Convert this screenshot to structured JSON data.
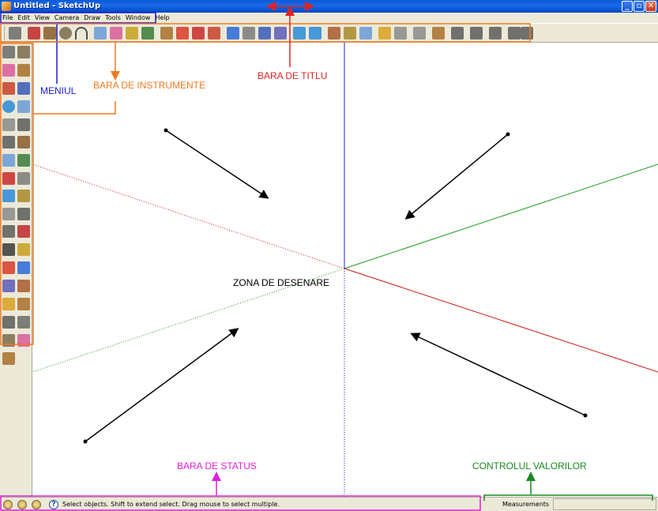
{
  "window": {
    "title": "Untitled - SketchUp",
    "buttons": {
      "minimize": "_",
      "maximize": "▫",
      "close": "✕"
    }
  },
  "menu": [
    "File",
    "Edit",
    "View",
    "Camera",
    "Draw",
    "Tools",
    "Window",
    "Help"
  ],
  "toolbar": {
    "tools": [
      "select-icon",
      "pencil-icon",
      "rectangle-icon",
      "circle-icon",
      "arc-icon",
      "make-component-icon",
      "eraser-icon",
      "tape-measure-icon",
      "paint-bucket-icon",
      "push-pull-icon",
      "move-icon",
      "rotate-icon",
      "follow-me-icon",
      "orbit-icon",
      "pan-icon",
      "zoom-icon",
      "zoom-extents-icon",
      "previous-view-icon",
      "next-view-icon",
      "position-camera-icon",
      "walk-icon",
      "look-around-icon",
      "section-plane-icon",
      "x-ray-icon",
      "wireframe-icon",
      "iso-view-icon",
      "top-view-icon",
      "front-view-icon",
      "right-view-icon",
      "back-view-icon",
      "left-view-icon"
    ]
  },
  "left_toolbar": {
    "tools": [
      "select-icon",
      "make-component-icon",
      "paint-bucket-icon",
      "eraser-icon",
      "rectangle-icon",
      "line-icon",
      "circle-icon",
      "arc-icon",
      "polygon-icon",
      "freehand-icon",
      "move-icon",
      "push-pull-icon",
      "rotate-icon",
      "follow-me-icon",
      "scale-icon",
      "offset-icon",
      "tape-measure-icon",
      "dimension-icon",
      "protractor-icon",
      "text-icon",
      "axes-icon",
      "3d-text-icon",
      "orbit-icon",
      "pan-icon",
      "zoom-icon",
      "zoom-window-icon",
      "zoom-extents-icon",
      "previous-icon",
      "position-camera-icon",
      "look-around-icon",
      "walk-icon",
      "section-plane-icon",
      "component-icon",
      "outliner-icon",
      "layers-icon"
    ]
  },
  "annotations": {
    "menu": "MENIUL",
    "toolbar": "BARA DE INSTRUMENTE",
    "titlebar": "BARA DE TITLU",
    "drawing_area": "ZONA DE DESENARE",
    "statusbar": "BARA DE STATUS",
    "value_control": "CONTROLUL VALORILOR"
  },
  "status": {
    "text": "Select objects. Shift to extend select. Drag mouse to select multiple.",
    "measurements_label": "Measurements",
    "measurements_value": ""
  },
  "colors": {
    "axis_blue": "#1f1fd6",
    "axis_green": "#1a9a1a",
    "axis_red": "#c81a1a",
    "ann_blue": "#1a1ad2",
    "ann_orange": "#f07820",
    "ann_red": "#e02222",
    "ann_magenta": "#e020d8",
    "ann_green": "#188820"
  }
}
